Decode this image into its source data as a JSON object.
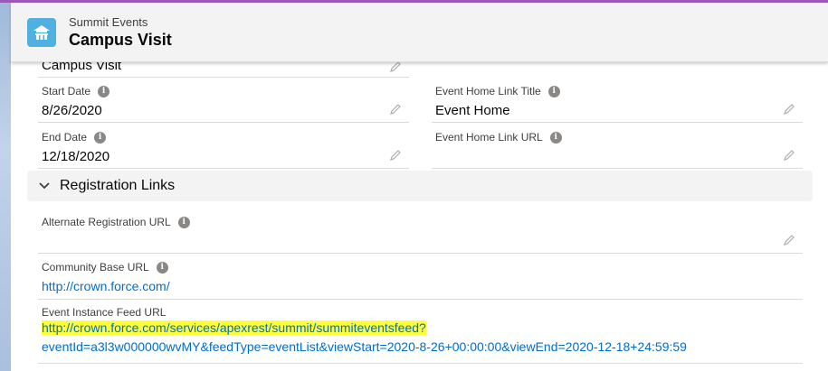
{
  "app": {
    "subtitle": "Summit Events",
    "title": "Campus Visit"
  },
  "fields": {
    "event_name_value": "Campus Visit",
    "start_date": {
      "label": "Start Date",
      "value": "8/26/2020"
    },
    "end_date": {
      "label": "End Date",
      "value": "12/18/2020"
    },
    "home_link_title": {
      "label": "Event Home Link Title",
      "value": "Event Home"
    },
    "home_link_url": {
      "label": "Event Home Link URL",
      "value": ""
    }
  },
  "section": {
    "title": "Registration Links"
  },
  "registration": {
    "alt_url": {
      "label": "Alternate Registration URL",
      "value": ""
    },
    "community_url": {
      "label": "Community Base URL",
      "value": "http://crown.force.com/"
    },
    "feed_url": {
      "label": "Event Instance Feed URL",
      "value_highlighted": "http://crown.force.com/services/apexrest/summit/summiteventsfeed?",
      "value_rest": "eventId=a3l3w000000wvMY&feedType=eventList&viewStart=2020-8-26+00:00:00&viewEnd=2020-12-18+24:59:59"
    }
  },
  "icons": {
    "info": "info-icon",
    "edit": "pencil-edit-icon",
    "chevron": "chevron-down-icon",
    "app": "summit-events-icon"
  },
  "colors": {
    "link": "#006dcc",
    "highlight": "#ffff38",
    "app_icon": "#50b0e0"
  }
}
